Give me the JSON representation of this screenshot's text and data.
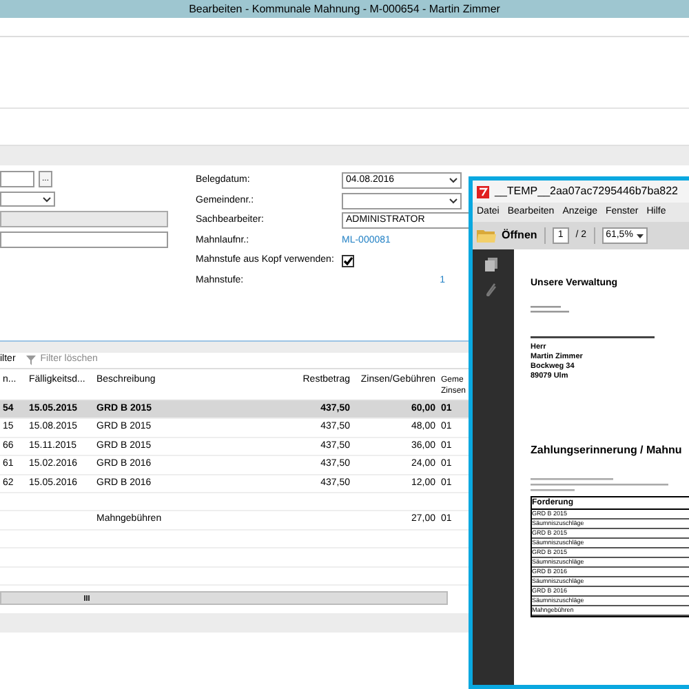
{
  "window": {
    "title": "Bearbeiten - Kommunale Mahnung - M-000654 - Martin Zimmer"
  },
  "form_left": [
    {
      "kind": "lookup",
      "button": "..."
    },
    {
      "kind": "select"
    },
    {
      "kind": "readonly"
    },
    {
      "kind": "text"
    }
  ],
  "form_right": [
    {
      "label": "Belegdatum:",
      "kind": "select",
      "value": "04.08.2016"
    },
    {
      "label": "Gemeindenr.:",
      "kind": "select"
    },
    {
      "label": "Sachbearbeiter:",
      "kind": "text",
      "value": "ADMINISTRATOR"
    },
    {
      "label": "Mahnlaufnr.:",
      "kind": "link",
      "value": "ML-000081"
    },
    {
      "label": "Mahnstufe aus Kopf verwenden:",
      "kind": "checkbox",
      "checked": true
    },
    {
      "label": "Mahnstufe:",
      "kind": "number",
      "value": "1"
    }
  ],
  "toolbar": [
    {
      "label": "ilter",
      "disabled": false
    },
    {
      "label": "Filter löschen",
      "disabled": true
    }
  ],
  "table": {
    "columns": [
      "n...",
      "Fälligkeitsd...",
      "Beschreibung",
      "Restbetrag",
      "Zinsen/Gebühren",
      "Geme Zinsen"
    ],
    "rows": [
      {
        "selected": true,
        "cells": [
          "54",
          "15.05.2015",
          "GRD B 2015",
          "437,50",
          "60,00",
          "01"
        ]
      },
      {
        "selected": false,
        "cells": [
          "15",
          "15.08.2015",
          "GRD B 2015",
          "437,50",
          "48,00",
          "01"
        ]
      },
      {
        "selected": false,
        "cells": [
          "66",
          "15.11.2015",
          "GRD B 2015",
          "437,50",
          "36,00",
          "01"
        ]
      },
      {
        "selected": false,
        "cells": [
          "61",
          "15.02.2016",
          "GRD B 2016",
          "437,50",
          "24,00",
          "01"
        ]
      },
      {
        "selected": false,
        "cells": [
          "62",
          "15.05.2016",
          "GRD B 2016",
          "437,50",
          "12,00",
          "01"
        ]
      },
      {
        "selected": false,
        "gap_before": true,
        "cells": [
          "",
          "",
          "Mahngebühren",
          "",
          "27,00",
          "01"
        ]
      }
    ]
  },
  "pdf_viewer": {
    "title": "__TEMP__2aa07ac7295446b7ba822",
    "menu": [
      "Datei",
      "Bearbeiten",
      "Anzeige",
      "Fenster",
      "Hilfe"
    ],
    "open_button": "Öffnen",
    "page": "1",
    "page_total": "/ 2",
    "zoom": "61,5%",
    "document": {
      "sender": "Unsere Verwaltung",
      "recipient": [
        "Herr",
        "Martin Zimmer",
        "Bockweg 34",
        "89079 Ulm"
      ],
      "heading": "Zahlungserinnerung / Mahnu",
      "table_header": "Forderung",
      "table_rows": [
        "GRD B 2015",
        "Säumniszuschläge",
        "GRD B 2015",
        "Säumniszuschläge",
        "GRD B 2015",
        "Säumniszuschläge",
        "GRD B 2016",
        "Säumniszuschläge",
        "GRD B 2016",
        "Säumniszuschläge",
        "Mahngebühren"
      ]
    }
  }
}
